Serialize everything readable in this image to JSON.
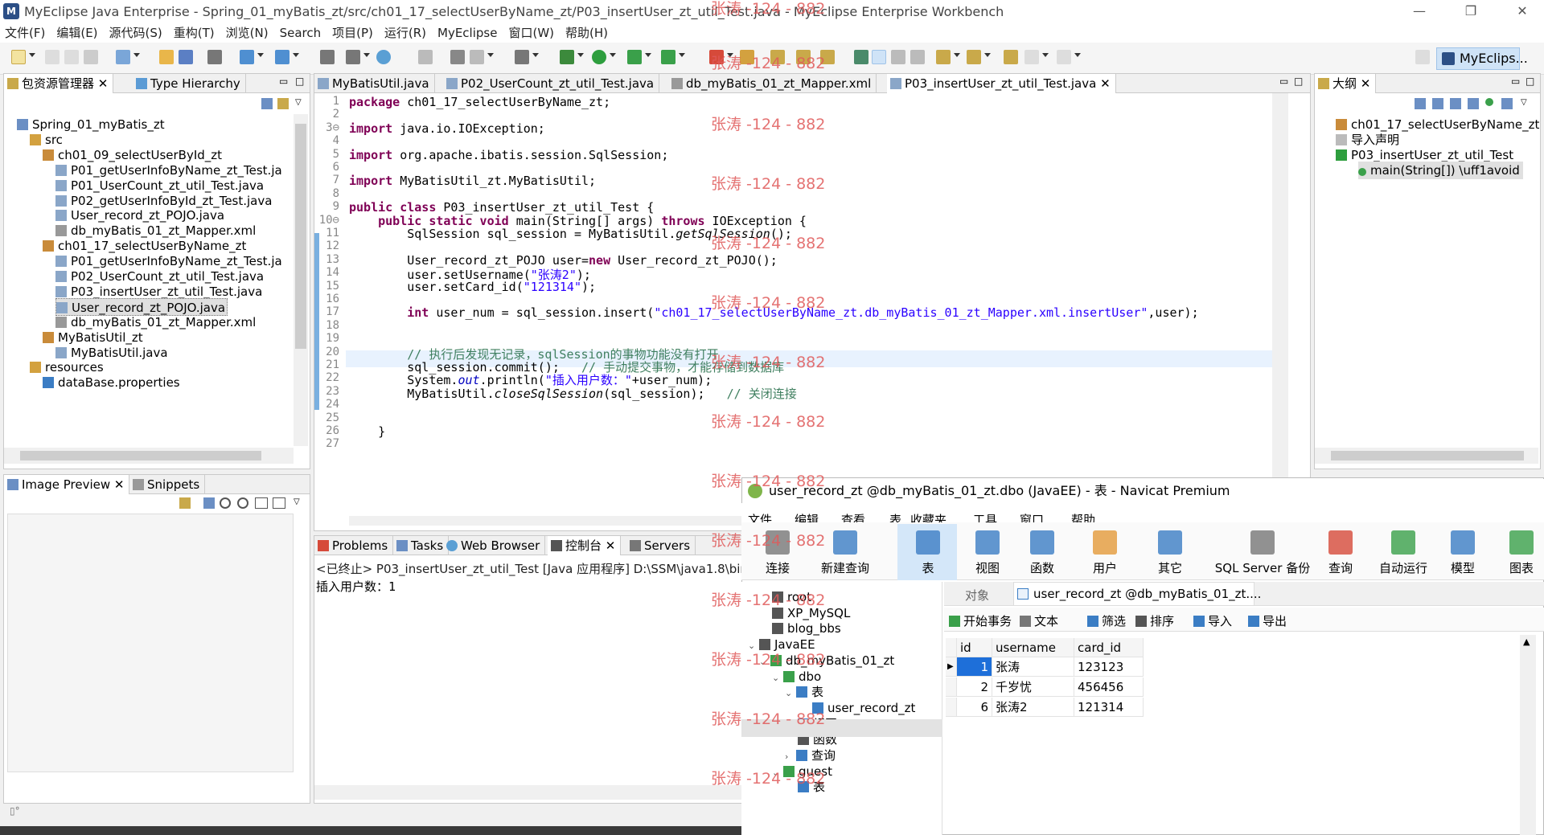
{
  "window": {
    "title": "MyEclipse Java Enterprise  -  Spring_01_myBatis_zt/src/ch01_17_selectUserByName_zt/P03_insertUser_zt_util_Test.java  -  MyEclipse Enterprise Workbench",
    "app_icon": "myeclipse-icon",
    "min": "—",
    "max": "❐",
    "close": "✕"
  },
  "menu": [
    "文件(F)",
    "编辑(E)",
    "源代码(S)",
    "重构(T)",
    "浏览(N)",
    "Search",
    "项目(P)",
    "运行(R)",
    "MyEclipse",
    "窗口(W)",
    "帮助(H)"
  ],
  "perspective": "MyEclips...",
  "left_panel": {
    "tabs": [
      "包资源管理器",
      "Type Hierarchy"
    ],
    "tree": [
      {
        "label": "Spring_01_myBatis_zt",
        "icon": "project-icon",
        "level": 0
      },
      {
        "label": "src",
        "icon": "source-folder-icon",
        "level": 1
      },
      {
        "label": "ch01_09_selectUserById_zt",
        "icon": "package-icon",
        "level": 2
      },
      {
        "label": "P01_getUserInfoByName_zt_Test.ja",
        "icon": "java-file-icon",
        "level": 3
      },
      {
        "label": "P01_UserCount_zt_util_Test.java",
        "icon": "java-file-icon",
        "level": 3
      },
      {
        "label": "P02_getUserInfoById_zt_Test.java",
        "icon": "java-file-icon",
        "level": 3
      },
      {
        "label": "User_record_zt_POJO.java",
        "icon": "java-file-icon",
        "level": 3
      },
      {
        "label": "db_myBatis_01_zt_Mapper.xml",
        "icon": "xml-file-icon",
        "level": 3
      },
      {
        "label": "ch01_17_selectUserByName_zt",
        "icon": "package-icon",
        "level": 2
      },
      {
        "label": "P01_getUserInfoByName_zt_Test.ja",
        "icon": "java-file-icon",
        "level": 3
      },
      {
        "label": "P02_UserCount_zt_util_Test.java",
        "icon": "java-file-icon",
        "level": 3
      },
      {
        "label": "P03_insertUser_zt_util_Test.java",
        "icon": "java-file-icon",
        "level": 3
      },
      {
        "label": "User_record_zt_POJO.java",
        "icon": "java-file-icon",
        "level": 3,
        "selected": true
      },
      {
        "label": "db_myBatis_01_zt_Mapper.xml",
        "icon": "xml-file-icon",
        "level": 3
      },
      {
        "label": "MyBatisUtil_zt",
        "icon": "package-icon",
        "level": 2
      },
      {
        "label": "MyBatisUtil.java",
        "icon": "java-file-icon",
        "level": 3
      },
      {
        "label": "resources",
        "icon": "folder-icon",
        "level": 1
      },
      {
        "label": "dataBase.properties",
        "icon": "properties-file-icon",
        "level": 2
      }
    ]
  },
  "bottom_left_panel": {
    "tabs": [
      "Image Preview",
      "Snippets"
    ]
  },
  "editor": {
    "tabs": [
      "MyBatisUtil.java",
      "P02_UserCount_zt_util_Test.java",
      "db_myBatis_01_zt_Mapper.xml",
      "P03_insertUser_zt_util_Test.java"
    ],
    "active_tab": 3,
    "line_numbers": [
      "1",
      "2",
      "3⊖",
      "4",
      "5",
      "6",
      "7",
      "8",
      "9",
      "10⊖",
      "11",
      "12",
      "13",
      "14",
      "15",
      "16",
      "17",
      "18",
      "19",
      "20",
      "21",
      "22",
      "23",
      "24",
      "25",
      "26",
      "27"
    ],
    "code_text": {
      "l1a": "package",
      "l1b": " ch01_17_selectUserByName_zt;",
      "l3a": "import",
      "l3b": " java.io.IOException;",
      "l5a": "import",
      "l5b": " org.apache.ibatis.session.SqlSession;",
      "l7a": "import",
      "l7b": " MyBatisUtil_zt.MyBatisUtil;",
      "l9a": "public class",
      "l9b": " P03_insertUser_zt_util_Test {",
      "l10a": "    ",
      "l10b": "public static void",
      "l10c": " main(String[] args) ",
      "l10d": "throws",
      "l10e": " IOException {",
      "l11a": "        SqlSession sql_session = MyBatisUtil.",
      "l11b": "getSqlSession",
      "l11c": "();",
      "l13a": "        User_record_zt_POJO user=",
      "l13b": "new",
      "l13c": " User_record_zt_POJO();",
      "l14a": "        user.setUsername(",
      "l14b": "\"张涛2\"",
      "l14c": ");",
      "l15a": "        user.setCard_id(",
      "l15b": "\"121314\"",
      "l15c": ");",
      "l17a": "        ",
      "l17b": "int",
      "l17c": " user_num = sql_session.insert(",
      "l17d": "\"ch01_17_selectUserByName_zt.db_myBatis_01_zt_Mapper.xml.insertUser\"",
      "l17e": ",user);",
      "l20a": "        ",
      "l20b": "// 执行后发现无记录，sqlSession的事物功能没有打开",
      "l21a": "        sql_session.commit();   ",
      "l21b": "// 手动提交事物，才能存储到数据库",
      "l22a": "        System.",
      "l22b": "out",
      "l22c": ".println(",
      "l22d": "\"插入用户数：\"",
      "l22e": "+user_num);",
      "l23a": "        MyBatisUtil.",
      "l23b": "closeSqlSession",
      "l23c": "(sql_session);   ",
      "l23d": "// 关闭连接",
      "l26a": "    }"
    }
  },
  "outline": {
    "tab": "大纲",
    "items": [
      {
        "label": "ch01_17_selectUserByName_zt",
        "icon": "package-icon"
      },
      {
        "label": "导入声明",
        "icon": "imports-icon"
      },
      {
        "label": "P03_insertUser_zt_util_Test",
        "icon": "class-icon"
      },
      {
        "label": "main(String[]) \\uff1avoid",
        "icon": "method-icon"
      }
    ]
  },
  "console": {
    "tabs": [
      "Problems",
      "Tasks",
      "Web Browser",
      "控制台",
      "Servers"
    ],
    "header": "<已终止> P03_insertUser_zt_util_Test [Java 应用程序] D:\\SSM\\java1.8\\bin\\ja",
    "output": "插入用户数：1"
  },
  "navicat": {
    "title": "user_record_zt @db_myBatis_01_zt.dbo (JavaEE) - 表 - Navicat Premium",
    "menu": [
      "文件",
      "编辑",
      "查看",
      "表",
      "收藏夹",
      "工具",
      "窗口",
      "帮助"
    ],
    "toolbar": [
      {
        "label": "连接",
        "icon": "connect-icon"
      },
      {
        "label": "新建查询",
        "icon": "new-query-icon"
      },
      {
        "label": "表",
        "icon": "table-icon"
      },
      {
        "label": "视图",
        "icon": "view-icon"
      },
      {
        "label": "函数",
        "icon": "function-icon"
      },
      {
        "label": "用户",
        "icon": "user-icon"
      },
      {
        "label": "其它",
        "icon": "other-icon"
      },
      {
        "label": "SQL Server 备份",
        "icon": "backup-icon"
      },
      {
        "label": "查询",
        "icon": "query-icon"
      },
      {
        "label": "自动运行",
        "icon": "autorun-icon"
      },
      {
        "label": "模型",
        "icon": "model-icon"
      },
      {
        "label": "图表",
        "icon": "chart-icon"
      }
    ],
    "tree": [
      {
        "label": "root",
        "icon": "server-icon"
      },
      {
        "label": "XP_MySQL",
        "icon": "server-icon"
      },
      {
        "label": "blog_bbs",
        "icon": "server-icon"
      },
      {
        "label": "JavaEE",
        "icon": "server-icon"
      },
      {
        "label": "db_myBatis_01_zt",
        "icon": "database-icon"
      },
      {
        "label": "dbo",
        "icon": "schema-icon"
      },
      {
        "label": "表",
        "icon": "tables-icon"
      },
      {
        "label": "user_record_zt",
        "icon": "table-icon"
      },
      {
        "label": "视图",
        "icon": "views-icon"
      },
      {
        "label": "函数",
        "icon": "functions-icon"
      },
      {
        "label": "查询",
        "icon": "queries-icon"
      },
      {
        "label": "guest",
        "icon": "schema-icon"
      },
      {
        "label": "表",
        "icon": "tables-icon"
      }
    ],
    "tabs": [
      "对象",
      "user_record_zt @db_myBatis_01_zt...."
    ],
    "grid_toolbar": [
      "开始事务",
      "文本",
      "筛选",
      "排序",
      "导入",
      "导出"
    ],
    "columns": [
      "id",
      "username",
      "card_id"
    ],
    "rows": [
      [
        "1",
        "张涛",
        "123123"
      ],
      [
        "2",
        "千岁忧",
        "456456"
      ],
      [
        "6",
        "张涛2",
        "121314"
      ]
    ]
  },
  "watermark": "张涛 -124 - 882"
}
